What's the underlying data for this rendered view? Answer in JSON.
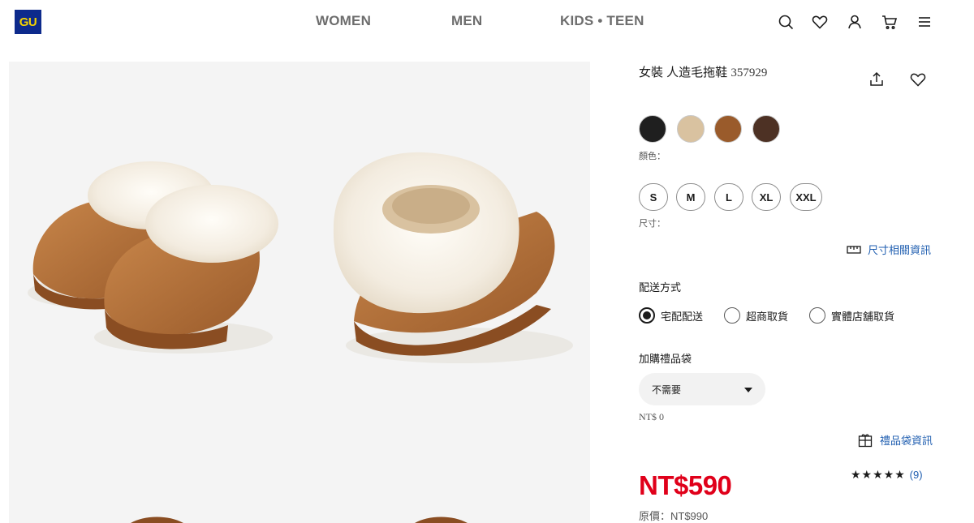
{
  "header": {
    "logo": "GU",
    "nav": [
      "WOMEN",
      "MEN",
      "KIDS • TEEN"
    ],
    "icons": [
      "search-icon",
      "heart-icon",
      "user-icon",
      "cart-icon",
      "menu-icon"
    ]
  },
  "product": {
    "name": "女裝 人造毛拖鞋",
    "code": "357929",
    "actions": [
      "share-icon",
      "heart-icon"
    ],
    "colors": {
      "label": "顏色：",
      "swatches": [
        "#1f1f1f",
        "#d9c2a0",
        "#9a5b2b",
        "#4d3124"
      ]
    },
    "sizes": {
      "label": "尺寸：",
      "options": [
        "S",
        "M",
        "L",
        "XL",
        "XXL"
      ]
    },
    "size_guide": "尺寸相關資訊",
    "delivery": {
      "title": "配送方式",
      "options": [
        "宅配配送",
        "超商取貨",
        "實體店舖取貨"
      ],
      "selected": "宅配配送"
    },
    "gift_bag": {
      "title": "加購禮品袋",
      "selected": "不需要",
      "price": "NT$ 0",
      "info_link": "禮品袋資訊"
    },
    "rating": {
      "stars": "★★★★★",
      "count": "(9)",
      "value": 5
    },
    "price": "NT$590",
    "original_price": "原價：NT$990",
    "accent_color": "#e0001a",
    "link_color": "#1f5eb0"
  }
}
